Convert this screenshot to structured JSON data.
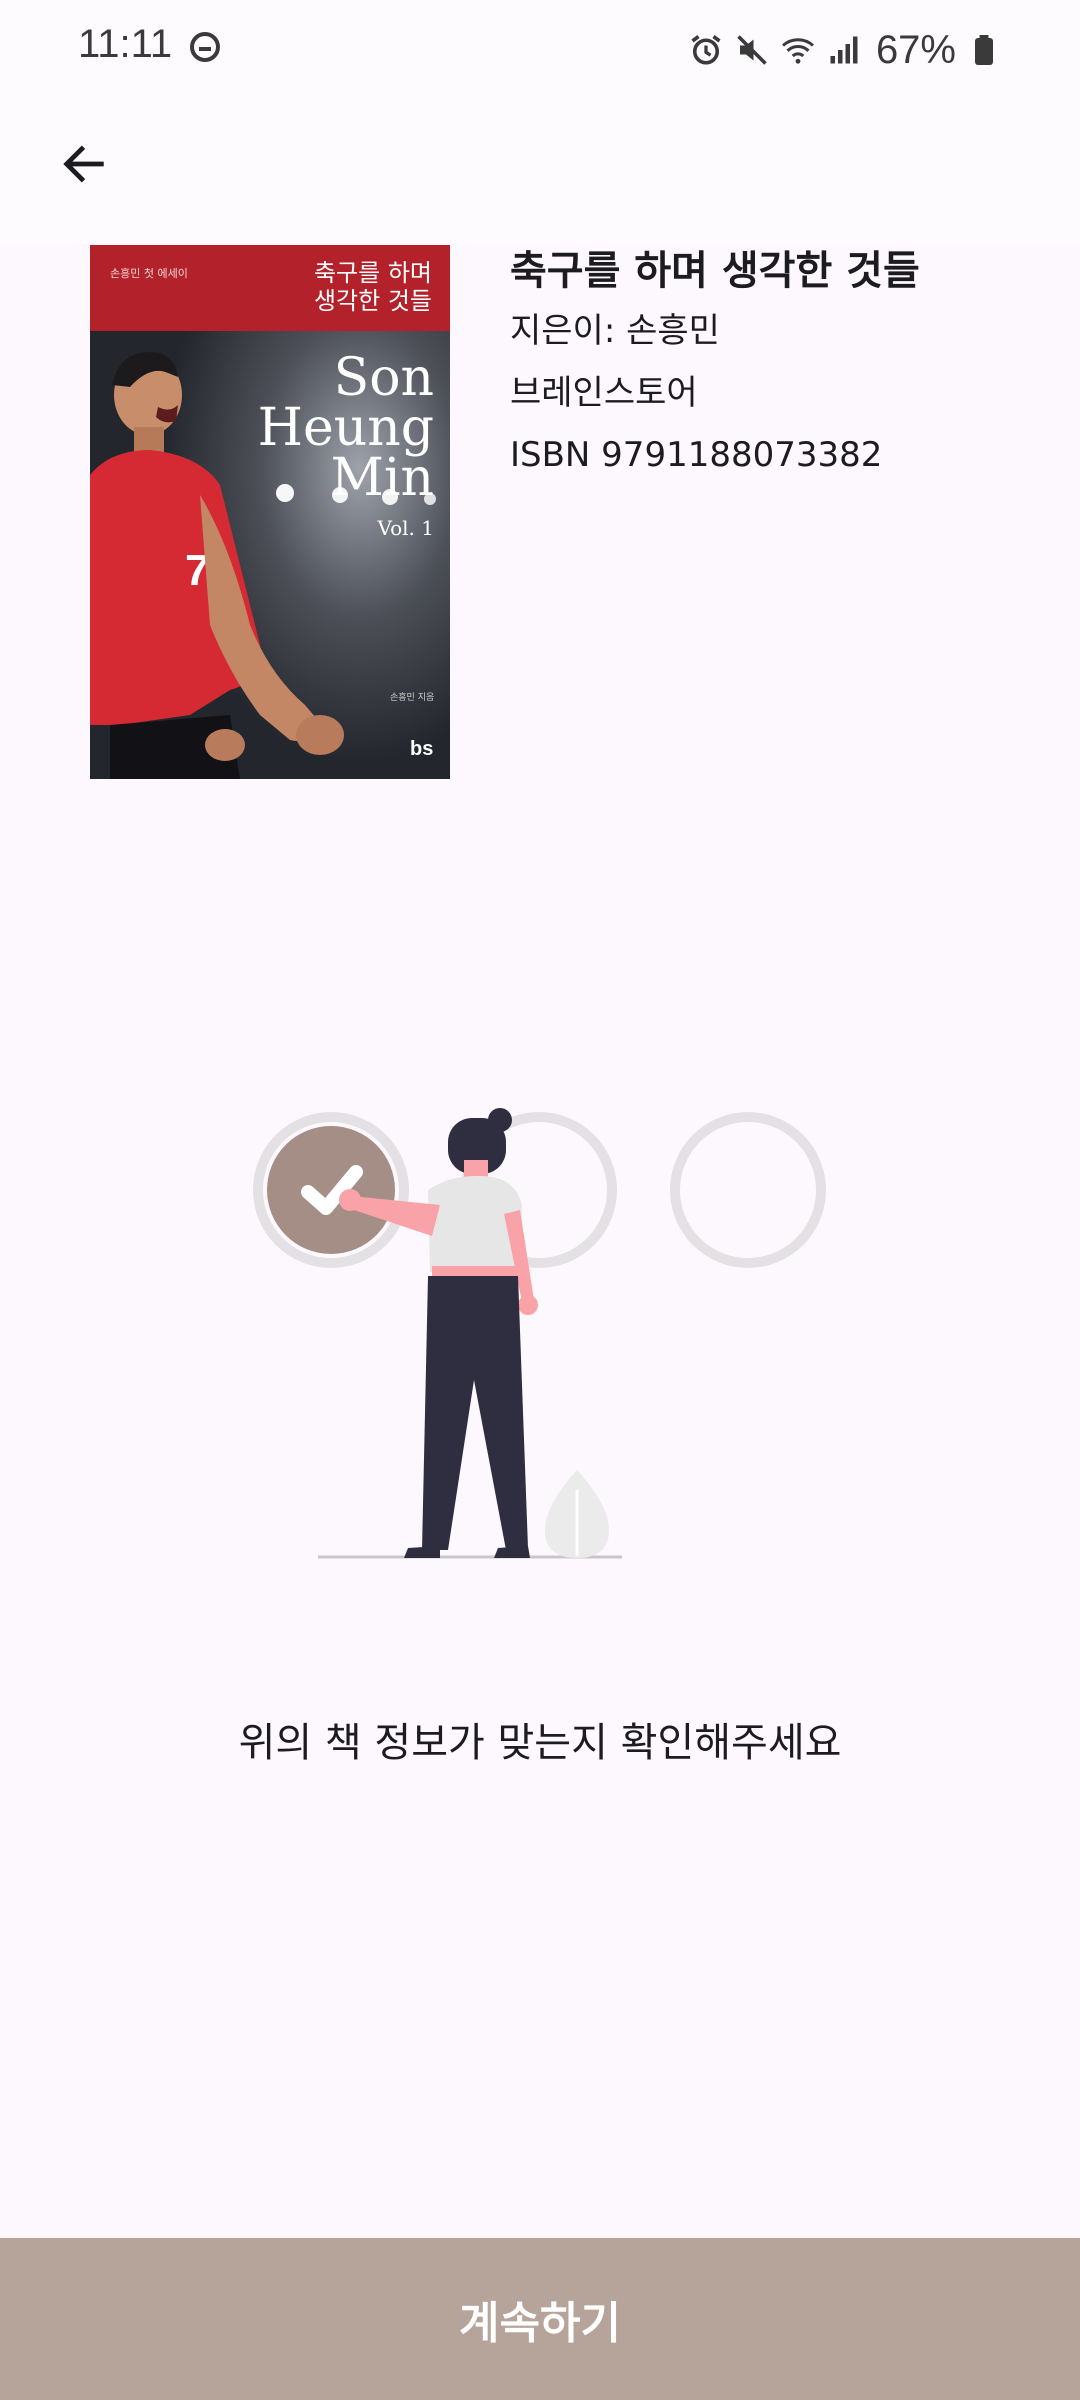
{
  "status_bar": {
    "time": "11:11",
    "battery_percent": "67%",
    "icons": [
      "do-not-disturb-icon",
      "alarm-icon",
      "mute-icon",
      "wifi-icon",
      "signal-icon",
      "battery-icon"
    ]
  },
  "app_bar": {
    "back_icon": "arrow-back-icon"
  },
  "book": {
    "cover": {
      "series_label": "손흥민 첫 에세이",
      "korean_title_line1": "축구를 하며",
      "korean_title_line2": "생각한 것들",
      "english_title_line1": "Son",
      "english_title_line2": "Heung",
      "english_title_line3": "Min",
      "volume": "Vol. 1",
      "publisher_logo": "bs",
      "jersey_number": "7",
      "band_color": "#b3222b"
    },
    "title": "축구를 하며 생각한 것들",
    "author": "지은이: 손흥민",
    "publisher": "브레인스토어",
    "isbn": "ISBN 9791188073382"
  },
  "illustration": {
    "selected_color": "#a48e86",
    "ring_color": "#e3e1e3"
  },
  "prompt": "위의 책 정보가 맞는지 확인해주세요",
  "continue_button": {
    "label": "계속하기",
    "color": "#b6a49b"
  }
}
